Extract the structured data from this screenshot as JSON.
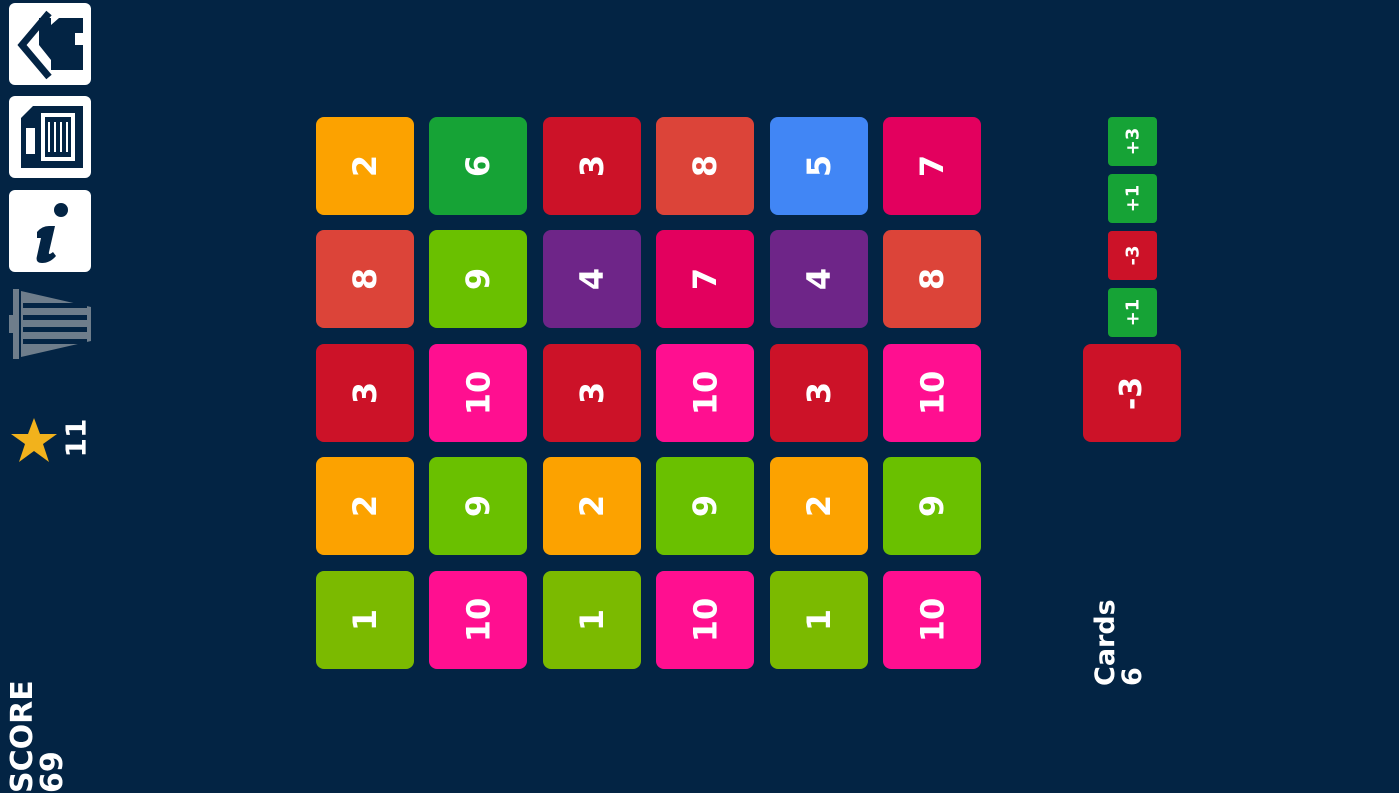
{
  "colors": {
    "background": "#032444",
    "star": "#f2b21c",
    "icon_dark": "#032444",
    "trash": "#6e7d8b"
  },
  "toolbar": [
    {
      "name": "home-icon"
    },
    {
      "name": "save-icon"
    },
    {
      "name": "info-icon"
    },
    {
      "name": "trash-icon"
    }
  ],
  "stars": {
    "icon": "star-icon",
    "count": "11"
  },
  "score": {
    "label": "SCORE",
    "value": "69"
  },
  "cards": {
    "label": "Cards",
    "value": "6"
  },
  "grid": {
    "columns": [
      [
        {
          "value": "2",
          "color": "#fca200"
        },
        {
          "value": "8",
          "color": "#dc4439"
        },
        {
          "value": "3",
          "color": "#cc1228"
        },
        {
          "value": "2",
          "color": "#fca200"
        },
        {
          "value": "1",
          "color": "#7bba00"
        }
      ],
      [
        {
          "value": "6",
          "color": "#16a336"
        },
        {
          "value": "9",
          "color": "#6ac000"
        },
        {
          "value": "10",
          "color": "#ff0f90"
        },
        {
          "value": "9",
          "color": "#6ac000"
        },
        {
          "value": "10",
          "color": "#ff0f90"
        }
      ],
      [
        {
          "value": "3",
          "color": "#cc1228"
        },
        {
          "value": "4",
          "color": "#6e2588"
        },
        {
          "value": "3",
          "color": "#cc1228"
        },
        {
          "value": "2",
          "color": "#fca200"
        },
        {
          "value": "1",
          "color": "#7bba00"
        }
      ],
      [
        {
          "value": "8",
          "color": "#dc4439"
        },
        {
          "value": "7",
          "color": "#e3005e"
        },
        {
          "value": "10",
          "color": "#ff0f90"
        },
        {
          "value": "9",
          "color": "#6ac000"
        },
        {
          "value": "10",
          "color": "#ff0f90"
        }
      ],
      [
        {
          "value": "5",
          "color": "#4186f5"
        },
        {
          "value": "4",
          "color": "#6e2588"
        },
        {
          "value": "3",
          "color": "#cc1228"
        },
        {
          "value": "2",
          "color": "#fca200"
        },
        {
          "value": "1",
          "color": "#7bba00"
        }
      ],
      [
        {
          "value": "7",
          "color": "#e3005e"
        },
        {
          "value": "8",
          "color": "#dc4439"
        },
        {
          "value": "10",
          "color": "#ff0f90"
        },
        {
          "value": "9",
          "color": "#6ac000"
        },
        {
          "value": "10",
          "color": "#ff0f90"
        }
      ]
    ]
  },
  "queue": [
    {
      "value": "+3",
      "color": "#16a336"
    },
    {
      "value": "+1",
      "color": "#16a336"
    },
    {
      "value": "-3",
      "color": "#cc1228"
    },
    {
      "value": "+1",
      "color": "#16a336"
    }
  ],
  "current_card": {
    "value": "-3",
    "color": "#cc1228"
  }
}
